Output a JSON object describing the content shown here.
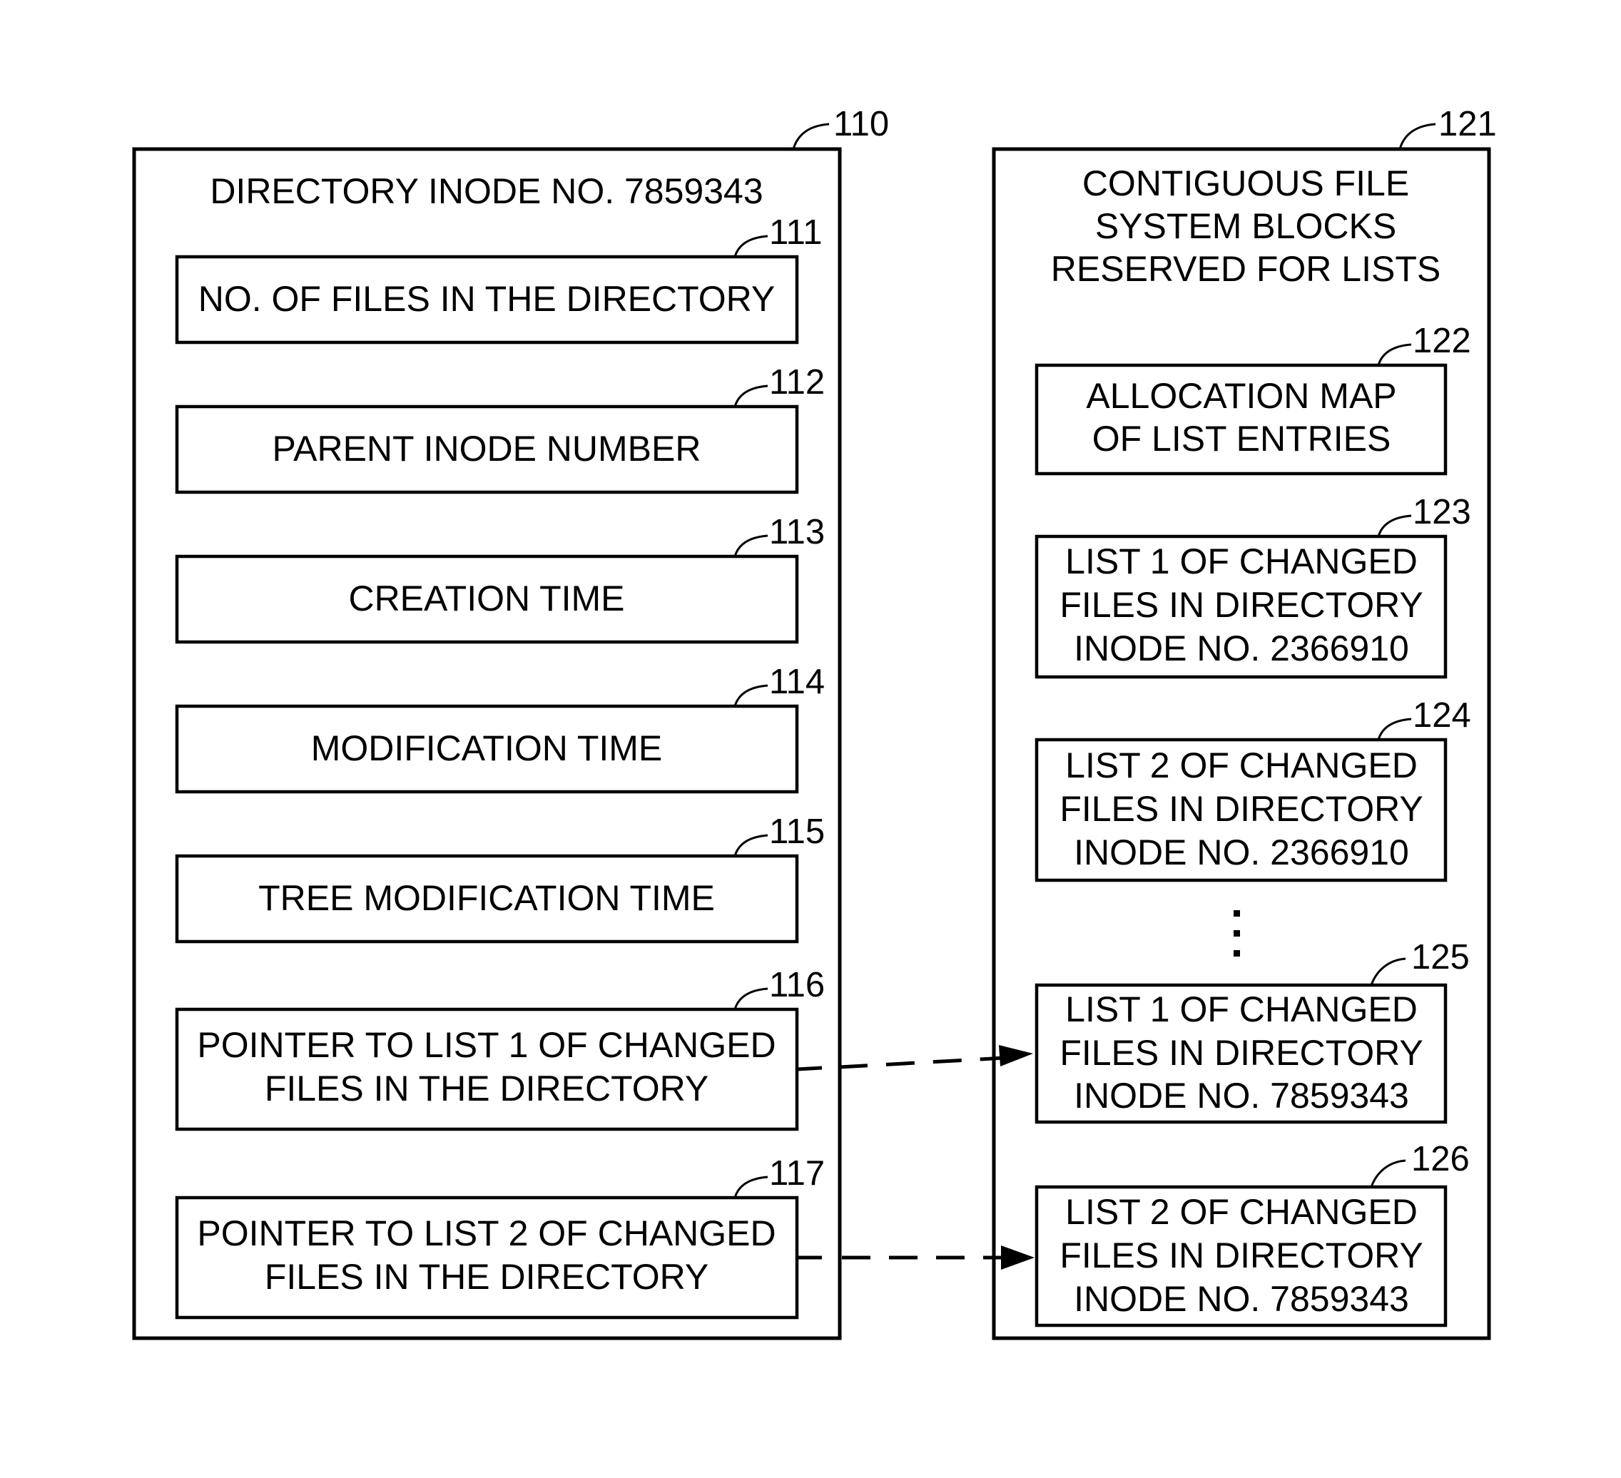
{
  "diagram": {
    "left_panel": {
      "ref": "110",
      "title": "DIRECTORY INODE NO. 7859343",
      "fields": [
        {
          "ref": "111",
          "lines": [
            "NO. OF FILES IN THE DIRECTORY"
          ]
        },
        {
          "ref": "112",
          "lines": [
            "PARENT INODE NUMBER"
          ]
        },
        {
          "ref": "113",
          "lines": [
            "CREATION TIME"
          ]
        },
        {
          "ref": "114",
          "lines": [
            "MODIFICATION TIME"
          ]
        },
        {
          "ref": "115",
          "lines": [
            "TREE MODIFICATION TIME"
          ]
        },
        {
          "ref": "116",
          "lines": [
            "POINTER TO LIST 1 OF CHANGED",
            "FILES IN THE DIRECTORY"
          ]
        },
        {
          "ref": "117",
          "lines": [
            "POINTER TO LIST 2 OF CHANGED",
            "FILES IN THE DIRECTORY"
          ]
        }
      ]
    },
    "right_panel": {
      "ref": "121",
      "title_lines": [
        "CONTIGUOUS FILE",
        "SYSTEM BLOCKS",
        "RESERVED FOR LISTS"
      ],
      "blocks": [
        {
          "ref": "122",
          "lines": [
            "ALLOCATION MAP",
            "OF  LIST ENTRIES"
          ]
        },
        {
          "ref": "123",
          "lines": [
            "LIST 1 OF CHANGED",
            "FILES IN  DIRECTORY",
            "INODE NO. 2366910"
          ]
        },
        {
          "ref": "124",
          "lines": [
            "LIST 2 OF CHANGED",
            "FILES IN  DIRECTORY",
            "INODE NO. 2366910"
          ]
        },
        {
          "ref": "125",
          "lines": [
            "LIST 1 OF CHANGED",
            "FILES IN  DIRECTORY",
            "INODE NO. 7859343"
          ]
        },
        {
          "ref": "126",
          "lines": [
            "LIST 2 OF CHANGED",
            "FILES IN  DIRECTORY",
            "INODE NO. 7859343"
          ]
        }
      ],
      "ellipsis": "vertical-ellipsis"
    },
    "connections": [
      {
        "from": "116",
        "to": "125",
        "style": "dashed-arrow"
      },
      {
        "from": "117",
        "to": "126",
        "style": "dashed-arrow"
      }
    ]
  }
}
